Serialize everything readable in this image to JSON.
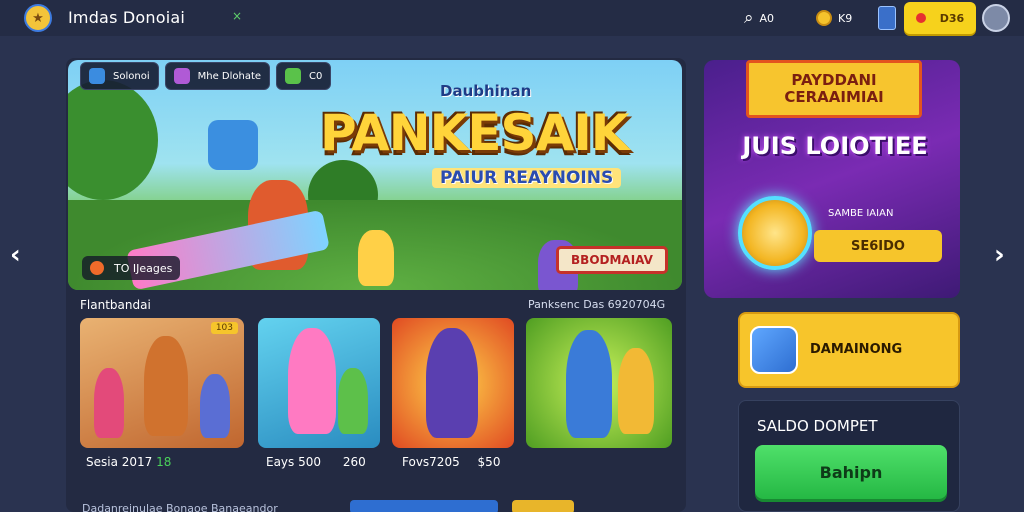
{
  "header": {
    "title": "Imdas Donoiai",
    "search_value": "A0",
    "coins_value": "K9",
    "cta_label": "D36",
    "icons": {
      "logo": "game-logo-icon",
      "search": "search-icon",
      "coin": "coin-icon",
      "avatar": "user-avatar-icon",
      "profile": "profile-icon"
    }
  },
  "hero": {
    "chips": [
      {
        "label": "Solonoi",
        "icon": "planet-icon",
        "color": "#3b8ce0"
      },
      {
        "label": "Mhe Dlohate",
        "icon": "gift-icon",
        "color": "#b05ad6"
      },
      {
        "label": "C0",
        "icon": "controller-icon",
        "color": "#5ac24a"
      }
    ],
    "kicker": "Daubhinan",
    "title": "PANKESAIK",
    "subtitle": "PAIUR REAYNOINS",
    "badge": "TO IJeages",
    "button": "BBODMAIAV"
  },
  "section": {
    "title": "Flantbandai",
    "meta": "Panksenc Das 6920704G"
  },
  "cards": [
    {
      "label": "Sesia 2017",
      "extra": "18",
      "tag": "103",
      "bg": "#d08545"
    },
    {
      "label": "Eays 500",
      "extra": "260",
      "tag": "",
      "bg": "#3db2d8"
    },
    {
      "label": "Fovs7205",
      "extra": "$50",
      "tag": "",
      "bg": "#e2582c"
    },
    {
      "label": "",
      "extra": "",
      "tag": "",
      "bg": "#6cbf2f"
    }
  ],
  "sidebar_banner": {
    "ribbon_line1": "PAYDDANI",
    "ribbon_line2": "CERAAIMIAI",
    "title": "JUIS LOIOTIEE",
    "label": "SAMBE IAIAN",
    "amount": "SE6IDO"
  },
  "promo": {
    "label": "DAMAINONG",
    "icon": "game-app-icon"
  },
  "wallet": {
    "title": "SALDO DOMPET",
    "button": "Bahipn"
  },
  "footer": {
    "text": "Dadanreinulae Bonaoe Banaeandor"
  }
}
